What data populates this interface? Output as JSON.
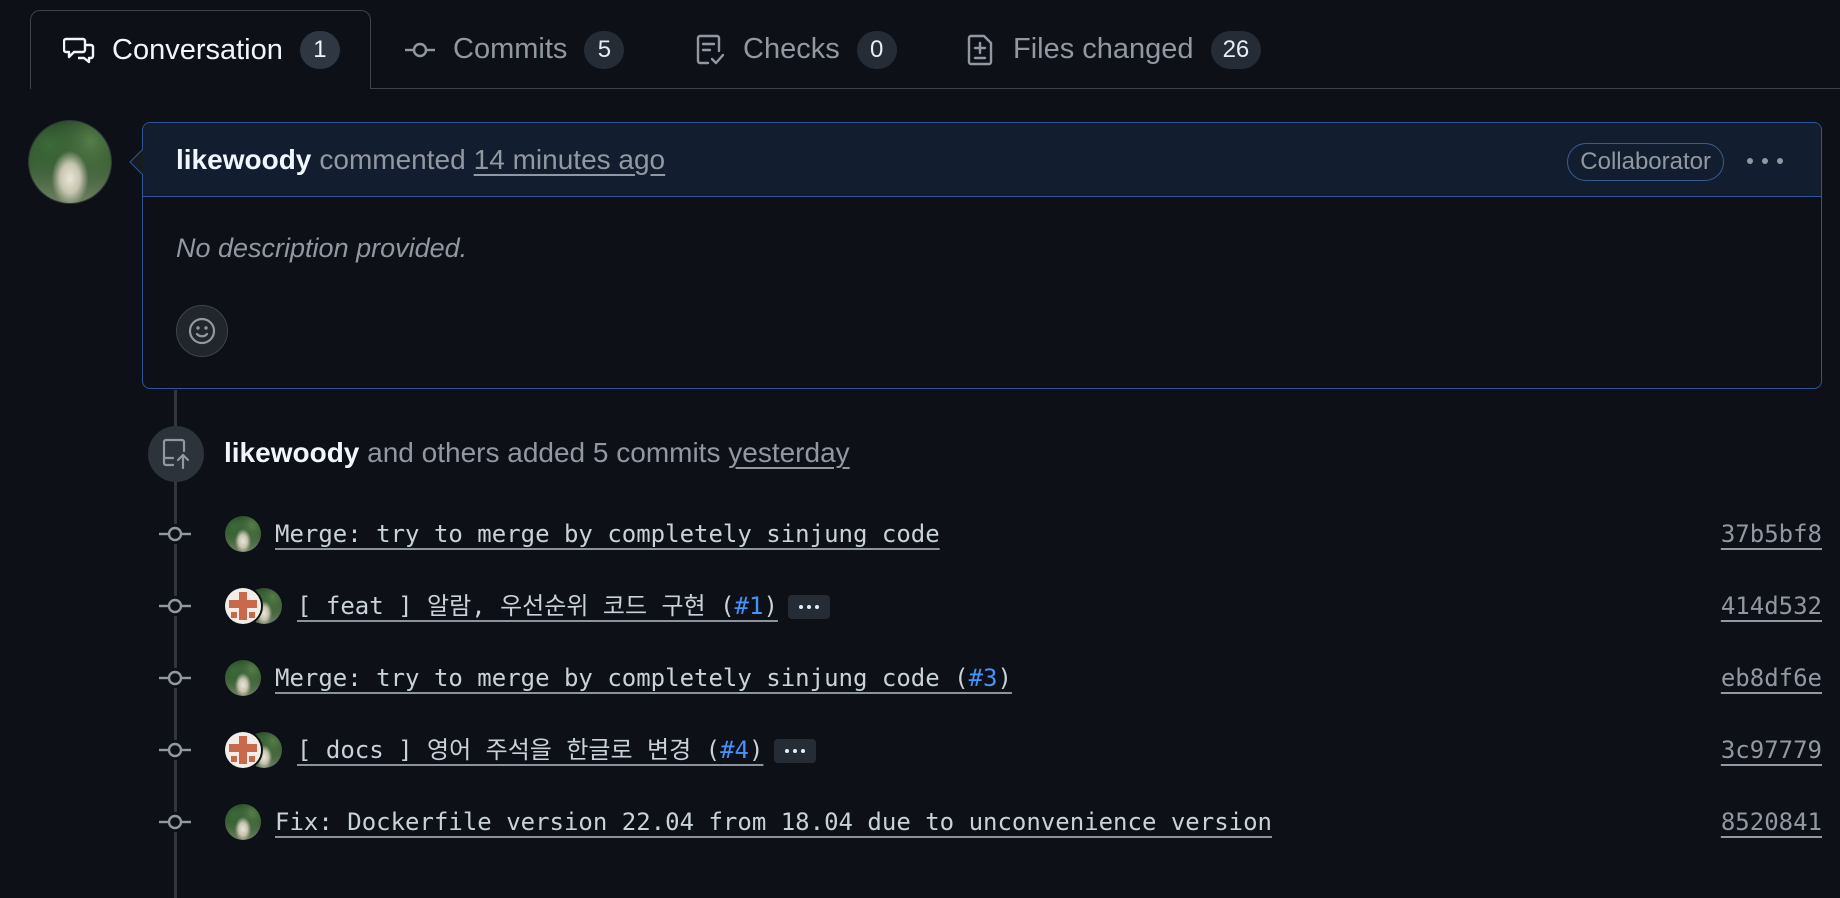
{
  "tabs": [
    {
      "label": "Conversation",
      "count": "1",
      "icon": "comment-discussion-icon"
    },
    {
      "label": "Commits",
      "count": "5",
      "icon": "git-commit-icon"
    },
    {
      "label": "Checks",
      "count": "0",
      "icon": "checklist-icon"
    },
    {
      "label": "Files changed",
      "count": "26",
      "icon": "file-diff-icon"
    }
  ],
  "comment": {
    "author": "likewoody",
    "action": "commented",
    "time": "14 minutes ago",
    "role": "Collaborator",
    "body": "No description provided."
  },
  "push_event": {
    "author": "likewoody",
    "text": "and others added 5 commits",
    "time": "yesterday"
  },
  "commits": [
    {
      "prefix": "Merge: try to merge by completely sinjung code",
      "issue": "",
      "suffix": "",
      "sha": "37b5bf8"
    },
    {
      "prefix": "[ feat ] 알람, 우선순위 코드 구현 (",
      "issue": "#1",
      "suffix": ")",
      "sha": "414d532"
    },
    {
      "prefix": "Merge: try to merge by completely sinjung code (",
      "issue": "#3",
      "suffix": ")",
      "sha": "eb8df6e"
    },
    {
      "prefix": "[ docs ] 영어 주석을 한글로 변경 (",
      "issue": "#4",
      "suffix": ")",
      "sha": "3c97779"
    },
    {
      "prefix": "Fix: Dockerfile version 22.04 from 18.04 due to unconvenience version",
      "issue": "",
      "suffix": "",
      "sha": "8520841"
    }
  ],
  "colors": {
    "background": "#0d1117",
    "accent_border": "#2f5499",
    "link": "#4493f8",
    "muted": "#9198a1"
  }
}
